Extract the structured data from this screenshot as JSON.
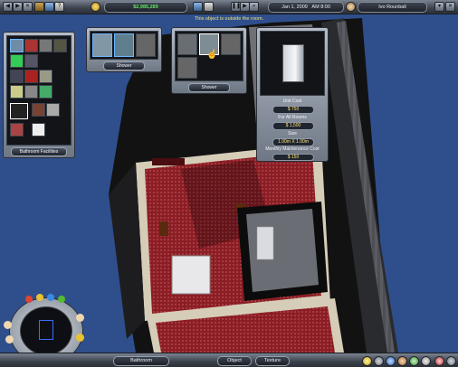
{
  "top_bar": {
    "money": "$2,985,289",
    "date": "Jan 1, 2009",
    "time": "AM 8:00",
    "player": "Ivo Rounball"
  },
  "message": "This object is outside the room.",
  "category_panel": {
    "caption": "Bathroom Facilities"
  },
  "shower_panel": {
    "caption": "Shower"
  },
  "variant_panel": {
    "caption": "Shower"
  },
  "info_panel": {
    "unit_cost_label": "Unit Cost",
    "unit_cost": "$ 750",
    "for_all_rooms_label": "For All Rooms",
    "for_all_rooms": "$ 1,500",
    "size_label": "Size",
    "size": "1.00m X 1.00m",
    "maintenance_label": "Monthly Maintenance Cost",
    "maintenance": "$ 150"
  },
  "bottom_bar": {
    "room": "Bathroom",
    "object_button": "Object",
    "texture_button": "Texture"
  },
  "colors": {
    "water": "#2f4f8c",
    "carpet": "#8c1d24",
    "accent_money": "#5ee35c",
    "message": "#f3e27a"
  }
}
